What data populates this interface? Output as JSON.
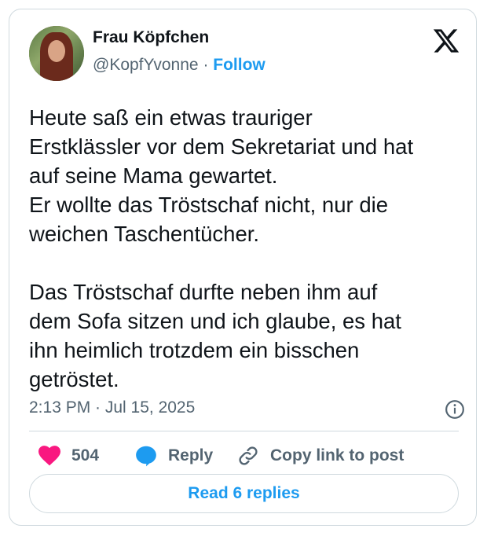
{
  "author": {
    "display_name": "Frau Köpfchen",
    "handle": "@KopfYvonne",
    "separator": "·",
    "follow_label": "Follow"
  },
  "tweet": {
    "text": "Heute saß ein etwas trauriger\nErstklässler vor dem Sekretariat und hat\nauf seine Mama gewartet.\nEr wollte das Tröstschaf nicht, nur die\nweichen Taschentücher.\n\nDas Tröstschaf durfte neben ihm auf\ndem Sofa sitzen und ich glaube, es hat\nihn heimlich trotzdem ein bisschen\ngetröstet.",
    "timestamp": "2:13 PM · Jul 15, 2025"
  },
  "actions": {
    "likes_count": "504",
    "reply_label": "Reply",
    "copy_link_label": "Copy link to post"
  },
  "footer": {
    "read_replies_label": "Read 6 replies"
  },
  "colors": {
    "accent": "#1d9bf0",
    "like": "#f91880",
    "muted": "#536471",
    "border": "#cfd9de"
  },
  "icons": [
    "x-logo-icon",
    "info-icon",
    "heart-icon",
    "reply-bubble-icon",
    "link-icon"
  ]
}
